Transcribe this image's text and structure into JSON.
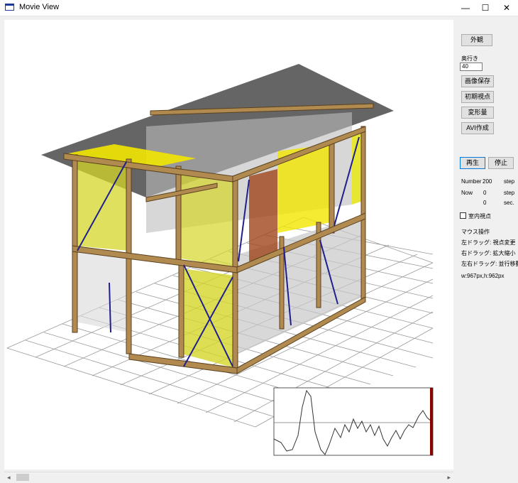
{
  "window": {
    "title": "Movie View",
    "minimize_glyph": "—",
    "maximize_glyph": "☐",
    "close_glyph": "✕"
  },
  "panel": {
    "exterior_button": "外観",
    "depth_label": "奥行き",
    "depth_value": "40",
    "save_image_button": "画像保存",
    "initial_view_button": "初期視点",
    "deformation_button": "変形量",
    "avi_button": "AVI作成",
    "play_button": "再生",
    "stop_button": "停止",
    "number_label": "Number",
    "number_value": "200",
    "number_unit": "step",
    "now_label": "Now",
    "now_value": "0",
    "now_unit": "step",
    "time_value": "0",
    "time_unit": "sec.",
    "indoor_view_label": "室内視点",
    "mouse_ops_label": "マウス操作",
    "left_drag": "左ドラッグ: 視点変更",
    "right_drag": "右ドラッグ: 拡大縮小",
    "both_drag": "左右ドラッグ: 並行移動",
    "size_info": "w:967px,h:962px"
  },
  "scrollbar": {
    "left_arrow": "◂",
    "right_arrow": "▸"
  },
  "icons": [
    "app-window-icon",
    "minimize-icon",
    "maximize-icon",
    "close-icon",
    "checkbox-icon",
    "scroll-left-arrow-icon",
    "scroll-right-arrow-icon"
  ],
  "colors": {
    "frame_wood": "#b08a4e",
    "frame_edge": "#5a4020",
    "panel_yellow": "#d6d62a",
    "bright_yellow": "#f2e600",
    "brace_blue": "#1f1f8f",
    "roof_gray": "#4a4a4a",
    "grid_line": "#9a9a9a",
    "accent_red": "#8b0000",
    "orange_wall": "#a0451a"
  }
}
